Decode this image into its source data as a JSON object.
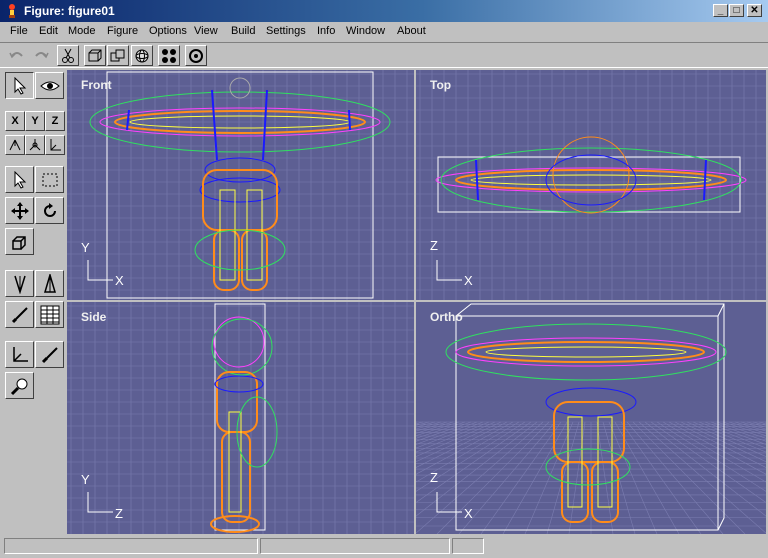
{
  "window": {
    "title": "Figure: figure01",
    "min": "_",
    "max": "□",
    "close": "✕"
  },
  "menu": [
    "File",
    "Edit",
    "Mode",
    "Figure",
    "Options",
    "View",
    "Build",
    "Settings",
    "Info",
    "Window",
    "About"
  ],
  "views": [
    {
      "label": "Front",
      "axis_v": "Y",
      "axis_h": "X"
    },
    {
      "label": "Top",
      "axis_v": "Z",
      "axis_h": "X"
    },
    {
      "label": "Side",
      "axis_v": "Y",
      "axis_h": "Z"
    },
    {
      "label": "Ortho",
      "axis_v": "Z",
      "axis_h": "X"
    }
  ],
  "axis_buttons": {
    "x": "X",
    "y": "Y",
    "z": "Z"
  },
  "colors": {
    "viewport_bg": "#5d5f93",
    "grid": "#7b7db0",
    "orange": "#ff8c1a",
    "yellow": "#ffff40",
    "green": "#30e060",
    "magenta": "#ff40ff",
    "blue": "#1a1aff"
  }
}
